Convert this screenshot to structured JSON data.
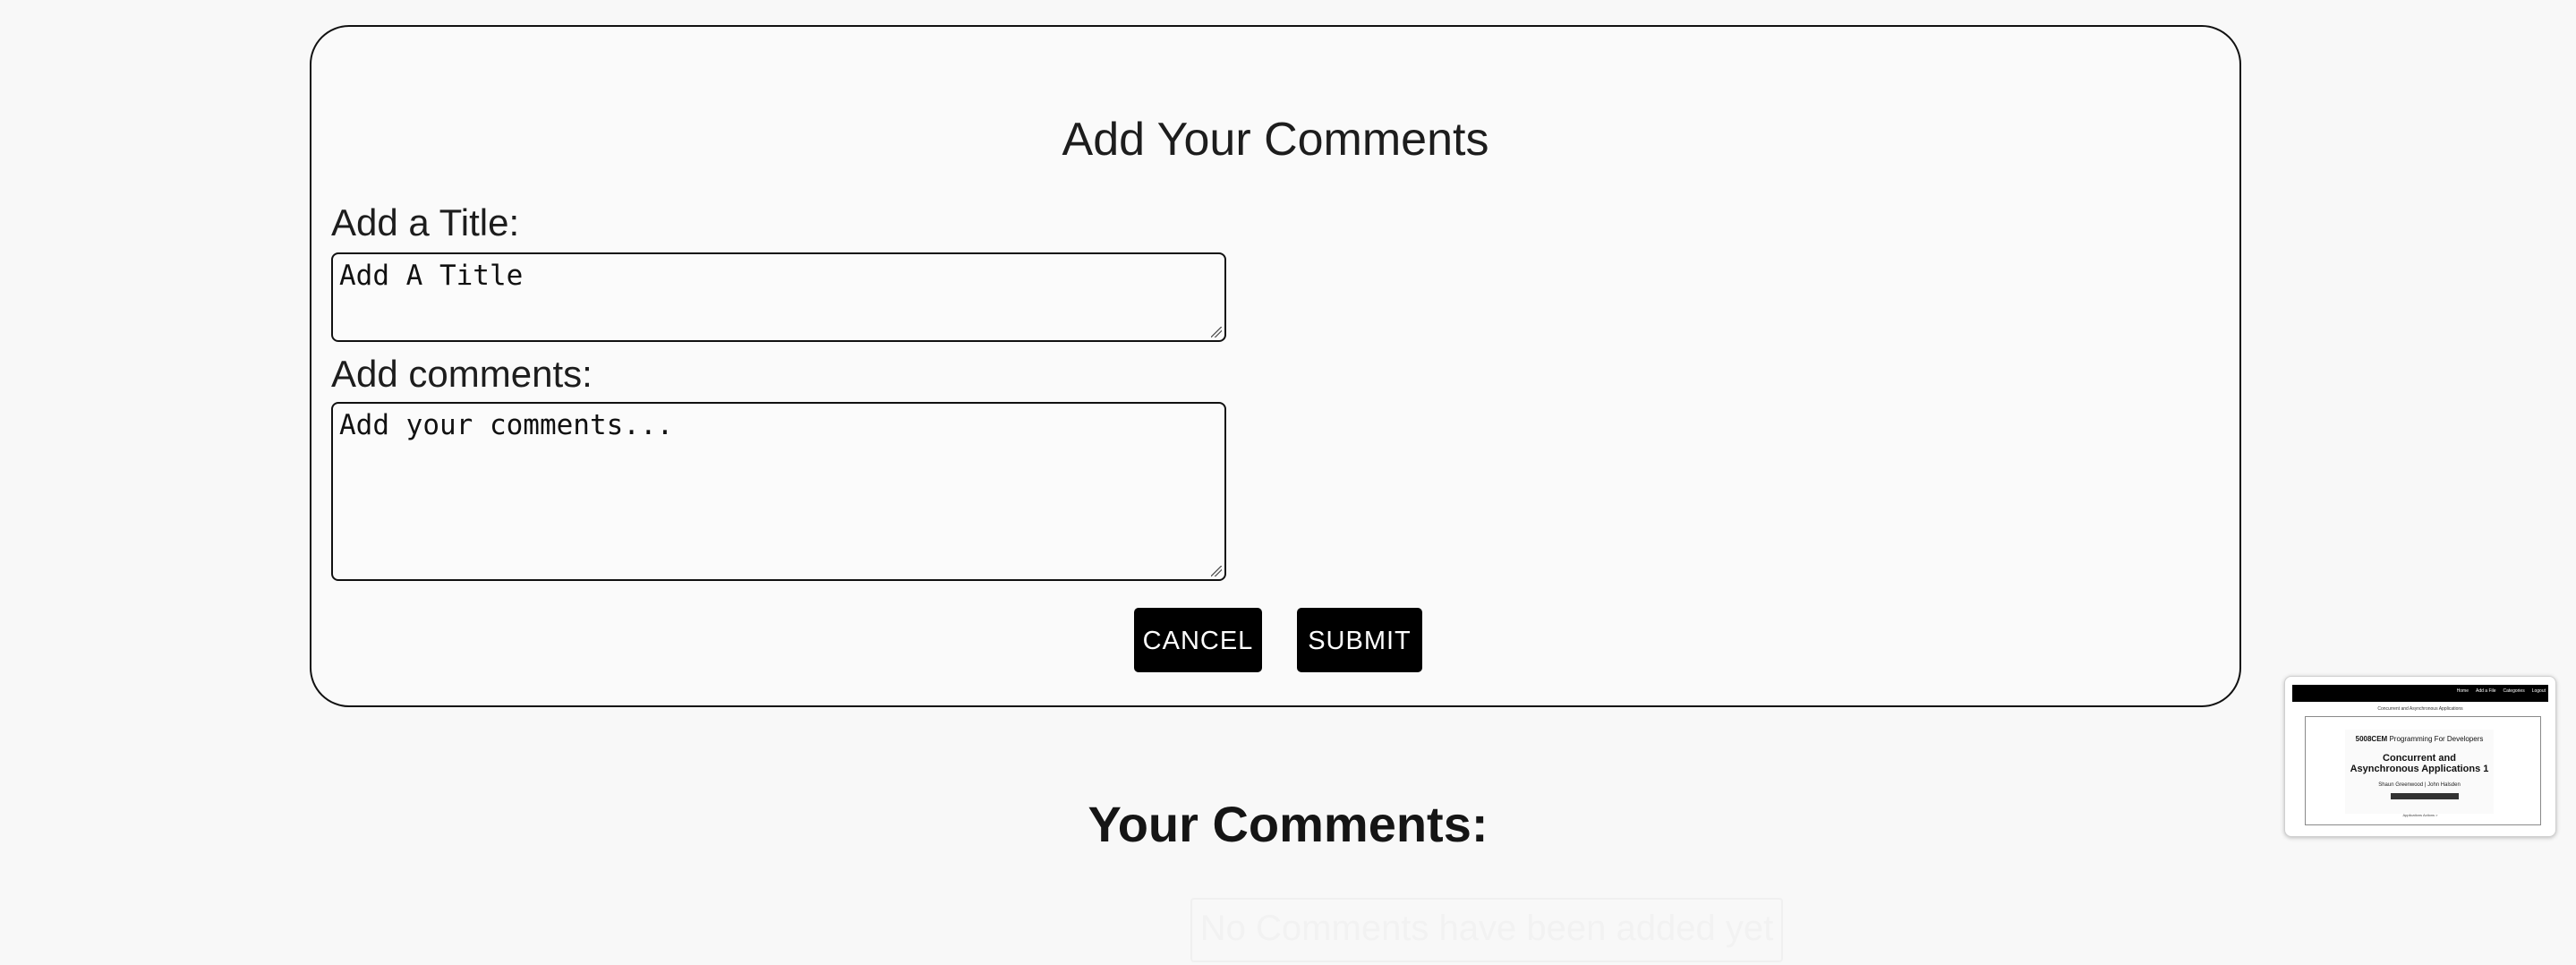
{
  "form": {
    "heading": "Add Your Comments",
    "title_label": "Add a Title:",
    "title_placeholder": "Add A Title",
    "comments_label": "Add comments:",
    "comments_placeholder": "Add your comments...",
    "cancel_label": "CANCEL",
    "submit_label": "SUBMIT"
  },
  "comments": {
    "heading": "Your Comments:",
    "empty_message": "No Comments have been added yet"
  },
  "preview": {
    "nav_links": [
      "Home",
      "Add a File",
      "Categories",
      "Logout"
    ],
    "subtitle": "Concurrent and Asynchronous Applications",
    "course_code": "5008CEM",
    "course_name": "Programming For Developers",
    "heading_line_1": "Concurrent and",
    "heading_line_2": "Asynchronous Applications 1",
    "authors": "Shaun Greenwood | John Halsden",
    "bottom_link": "Applications Actions >"
  },
  "colors": {
    "background": "#f8f8f8",
    "border": "#111111",
    "button_background": "#000000",
    "button_text": "#ffffff",
    "empty_text": "#f2f2f2"
  }
}
